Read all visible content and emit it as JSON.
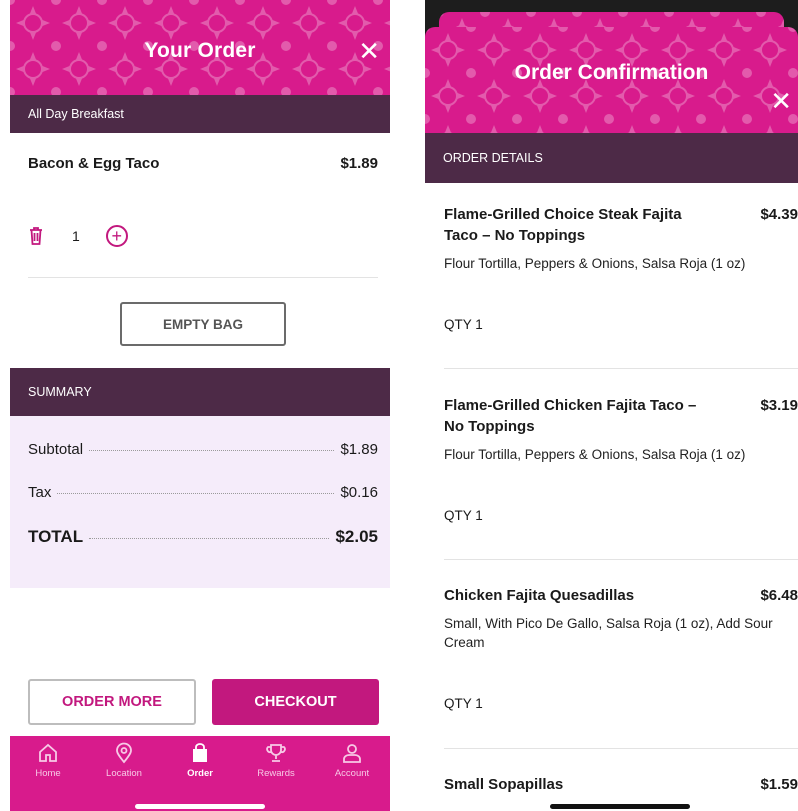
{
  "left": {
    "header": {
      "title": "Your Order"
    },
    "category": "All Day Breakfast",
    "item": {
      "name": "Bacon & Egg Taco",
      "price": "$1.89",
      "quantity": "1"
    },
    "empty_bag_label": "EMPTY BAG",
    "summary": {
      "header": "SUMMARY",
      "subtotal_label": "Subtotal",
      "subtotal_value": "$1.89",
      "tax_label": "Tax",
      "tax_value": "$0.16",
      "total_label": "TOTAL",
      "total_value": "$2.05"
    },
    "order_more_label": "ORDER MORE",
    "checkout_label": "CHECKOUT",
    "tabs": [
      {
        "label": "Home",
        "icon": "home-icon"
      },
      {
        "label": "Location",
        "icon": "location-pin-icon"
      },
      {
        "label": "Order",
        "icon": "bag-icon",
        "active": true
      },
      {
        "label": "Rewards",
        "icon": "trophy-icon"
      },
      {
        "label": "Account",
        "icon": "person-icon"
      }
    ]
  },
  "right": {
    "header": {
      "title": "Order Confirmation"
    },
    "details_header": "ORDER DETAILS",
    "items": [
      {
        "name": "Flame-Grilled Choice Steak Fajita Taco – No Toppings",
        "price": "$4.39",
        "description": "Flour Tortilla, Peppers & Onions, Salsa Roja (1 oz)",
        "qty": "QTY 1"
      },
      {
        "name": "Flame-Grilled Chicken Fajita Taco – No Toppings",
        "price": "$3.19",
        "description": "Flour Tortilla, Peppers & Onions, Salsa Roja (1 oz)",
        "qty": "QTY 1"
      },
      {
        "name": "Chicken Fajita Quesadillas",
        "price": "$6.48",
        "description": "Small, With Pico De Gallo, Salsa Roja (1 oz), Add Sour Cream",
        "qty": "QTY 1"
      },
      {
        "name": "Small Sopapillas",
        "price": "$1.59"
      }
    ]
  },
  "colors": {
    "brand_pink": "#d81b8c",
    "accent_magenta": "#c2187e",
    "plum": "#4d2a47",
    "summary_bg": "#f5ecfa"
  }
}
